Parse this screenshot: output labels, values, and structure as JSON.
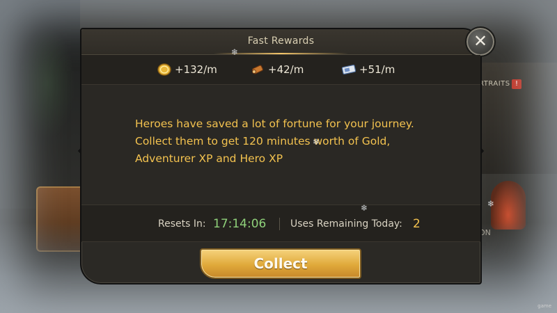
{
  "dialog": {
    "title": "Fast Rewards",
    "close_symbol": "✕",
    "rates": [
      {
        "icon": "gold-coin-icon",
        "value": "+132/m"
      },
      {
        "icon": "adventurer-xp-scroll-icon",
        "value": "+42/m"
      },
      {
        "icon": "hero-xp-ticket-icon",
        "value": "+51/m"
      }
    ],
    "description": "Heroes have saved a lot of fortune for your journey. Collect them to get 120 minutes worth of Gold, Adventurer XP and Hero XP",
    "resets_label": "Resets In:",
    "resets_value": "17:14:06",
    "uses_label": "Uses Remaining Today:",
    "uses_value": "2",
    "collect_label": "Collect"
  },
  "background": {
    "portraits_tag": "RTRAITS",
    "alert_symbol": "!",
    "on_tag": "ON",
    "watermark": "game"
  },
  "colors": {
    "accent_gold": "#f3c24f",
    "timer_green": "#8fd17a",
    "button_gold": "#e0a93a"
  }
}
